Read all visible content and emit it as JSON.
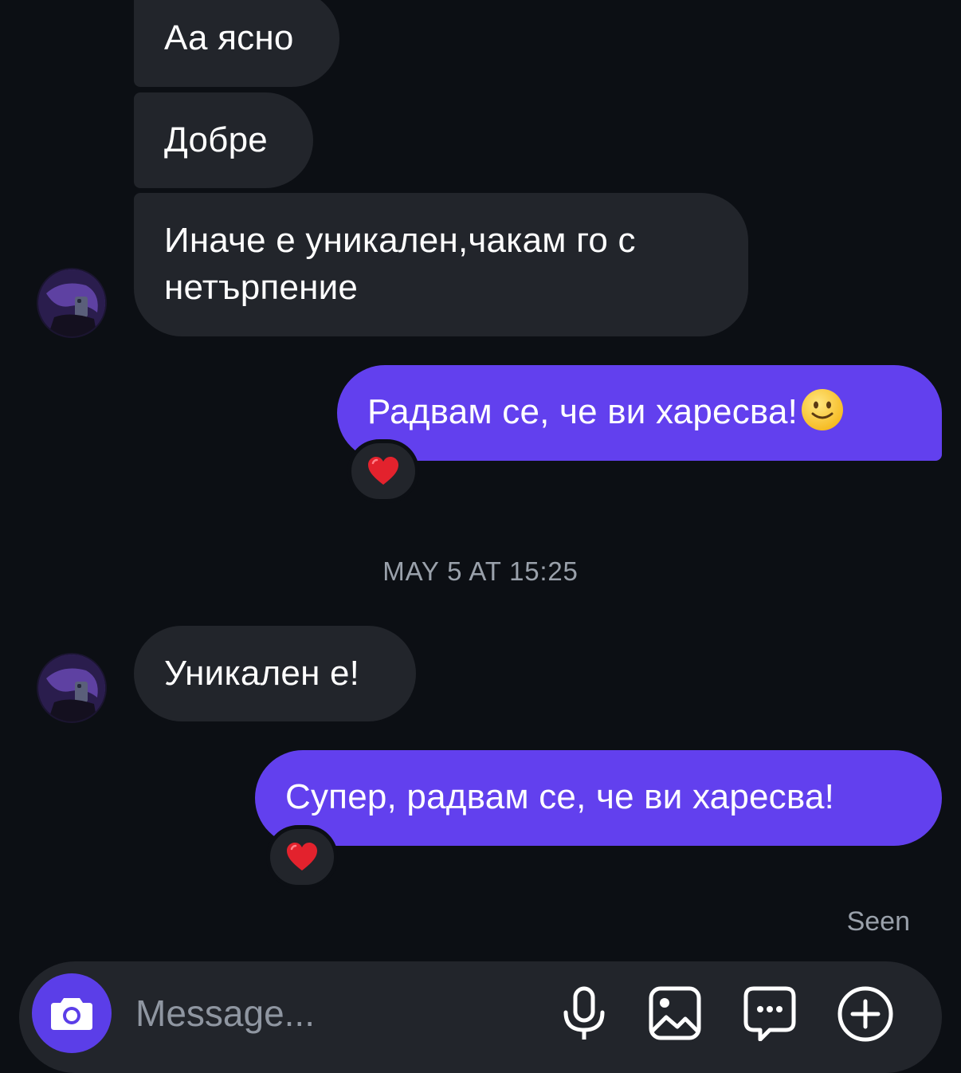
{
  "messages": {
    "in_1": "Аа ясно",
    "in_2": "Добре",
    "in_3": "Иначе е уникален,чакам го с нетърпение",
    "out_1": "Радвам се, че ви харесва!",
    "out_1_emoji": "slightly-smiling-face",
    "out_1_reaction": "❤️",
    "in_4": "Уникален е!",
    "out_2": "Супер, радвам се, че ви харесва!",
    "out_2_reaction": "❤️"
  },
  "timestamp": "MAY 5 AT 15:25",
  "status": "Seen",
  "composer": {
    "placeholder": "Message...",
    "icons": [
      "camera-icon",
      "microphone-icon",
      "gallery-icon",
      "sticker-chat-icon",
      "plus-icon"
    ]
  },
  "colors": {
    "background": "#0c0f14",
    "incoming_bubble": "#22252b",
    "outgoing_bubble": "#6240ee",
    "camera_button": "#5b3ee8",
    "muted_text": "#9aa1ab"
  }
}
